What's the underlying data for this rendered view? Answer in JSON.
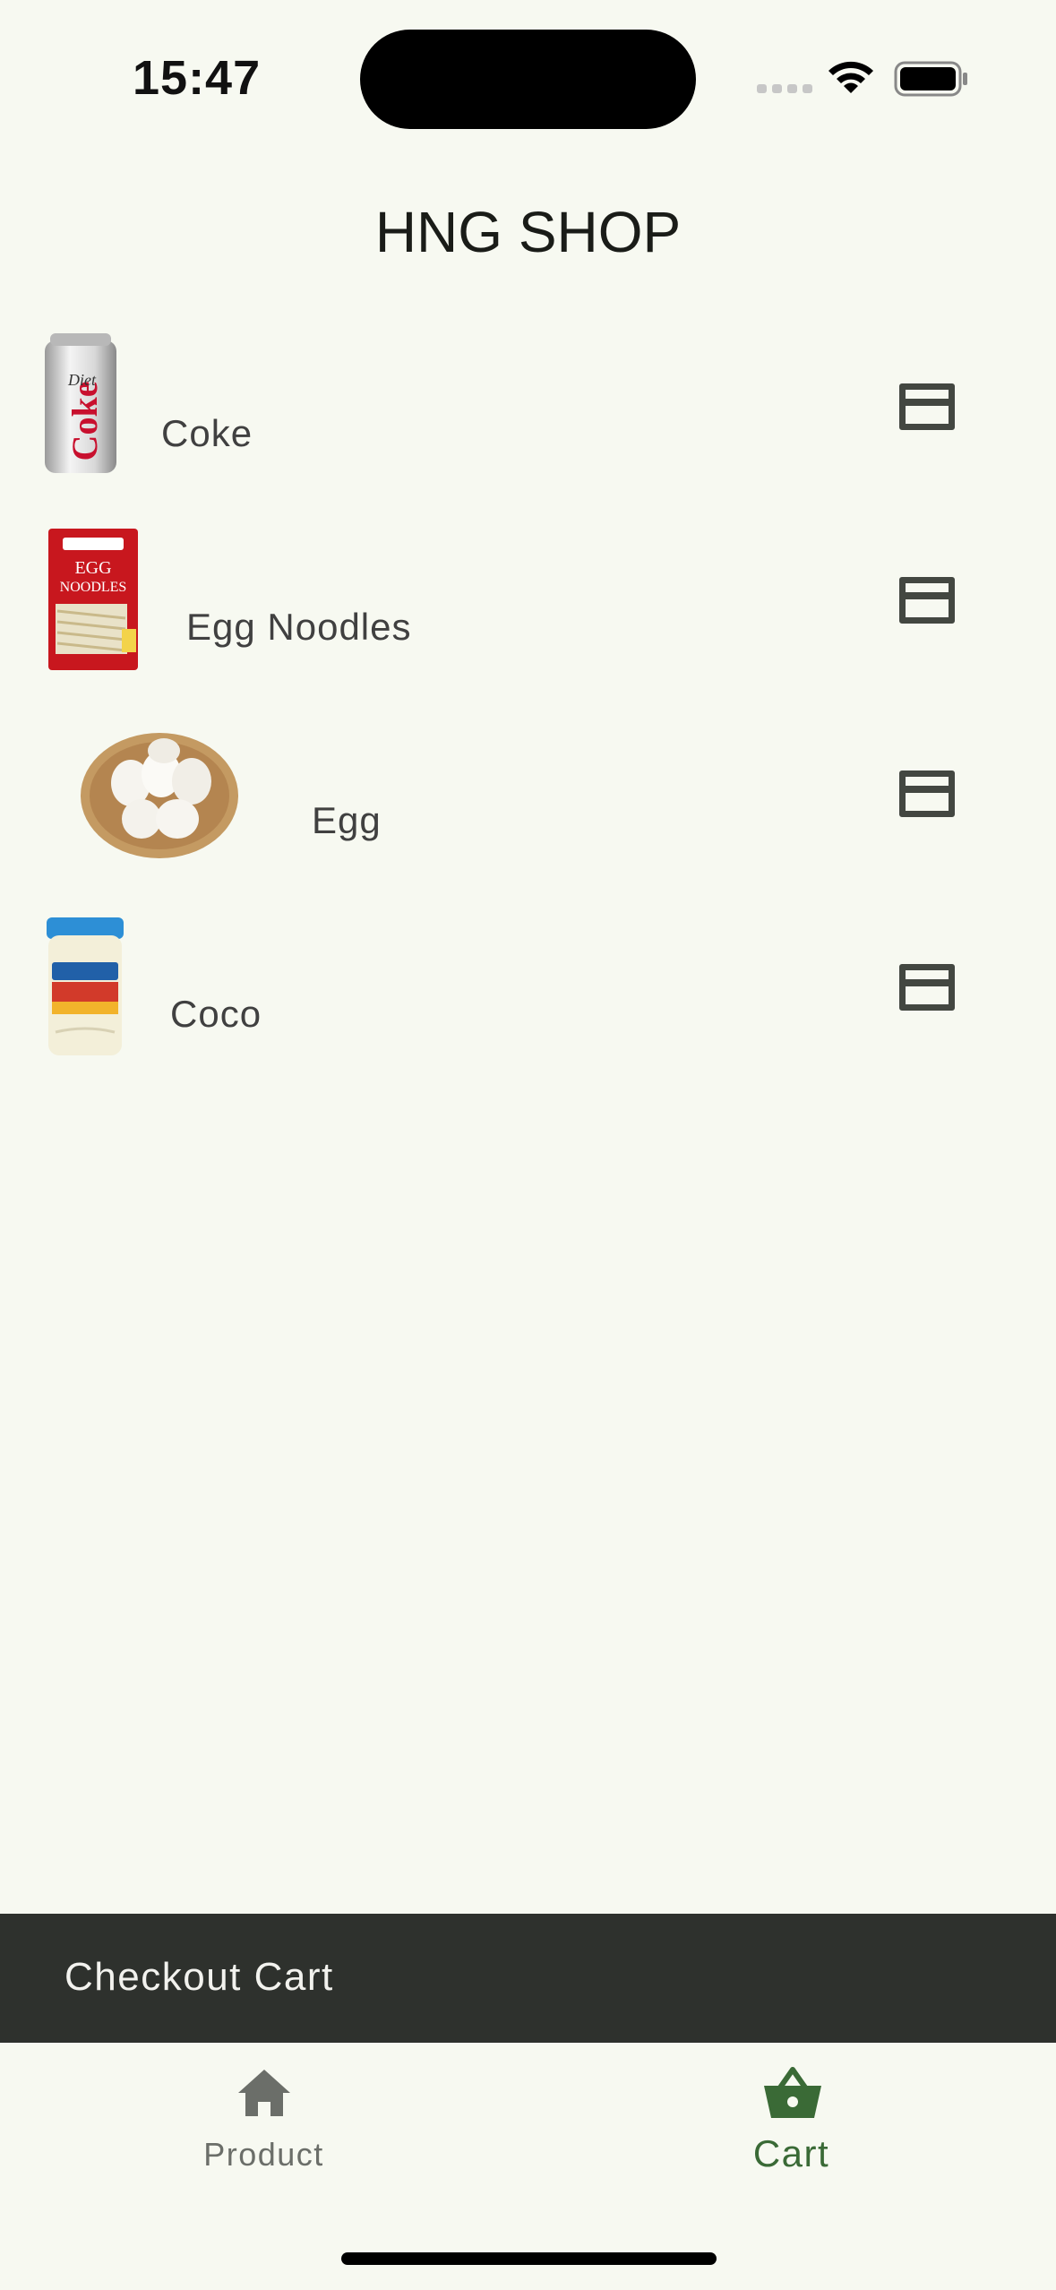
{
  "status_bar": {
    "time": "15:47"
  },
  "app": {
    "title": "HNG SHOP"
  },
  "products": [
    {
      "name": "Coke",
      "icon": "credit-card-icon"
    },
    {
      "name": "Egg Noodles",
      "icon": "credit-card-icon"
    },
    {
      "name": "Egg",
      "icon": "credit-card-icon"
    },
    {
      "name": "Coco",
      "icon": "credit-card-icon"
    }
  ],
  "checkout": {
    "label": "Checkout Cart"
  },
  "nav": {
    "items": [
      {
        "label": "Product",
        "icon": "home-icon",
        "selected": false
      },
      {
        "label": "Cart",
        "icon": "shopping-basket-icon",
        "selected": true
      }
    ]
  },
  "colors": {
    "background": "#f7f9f1",
    "checkout_bar": "#2e312d",
    "accent": "#3a6a36",
    "inactive": "#6b6e69"
  }
}
